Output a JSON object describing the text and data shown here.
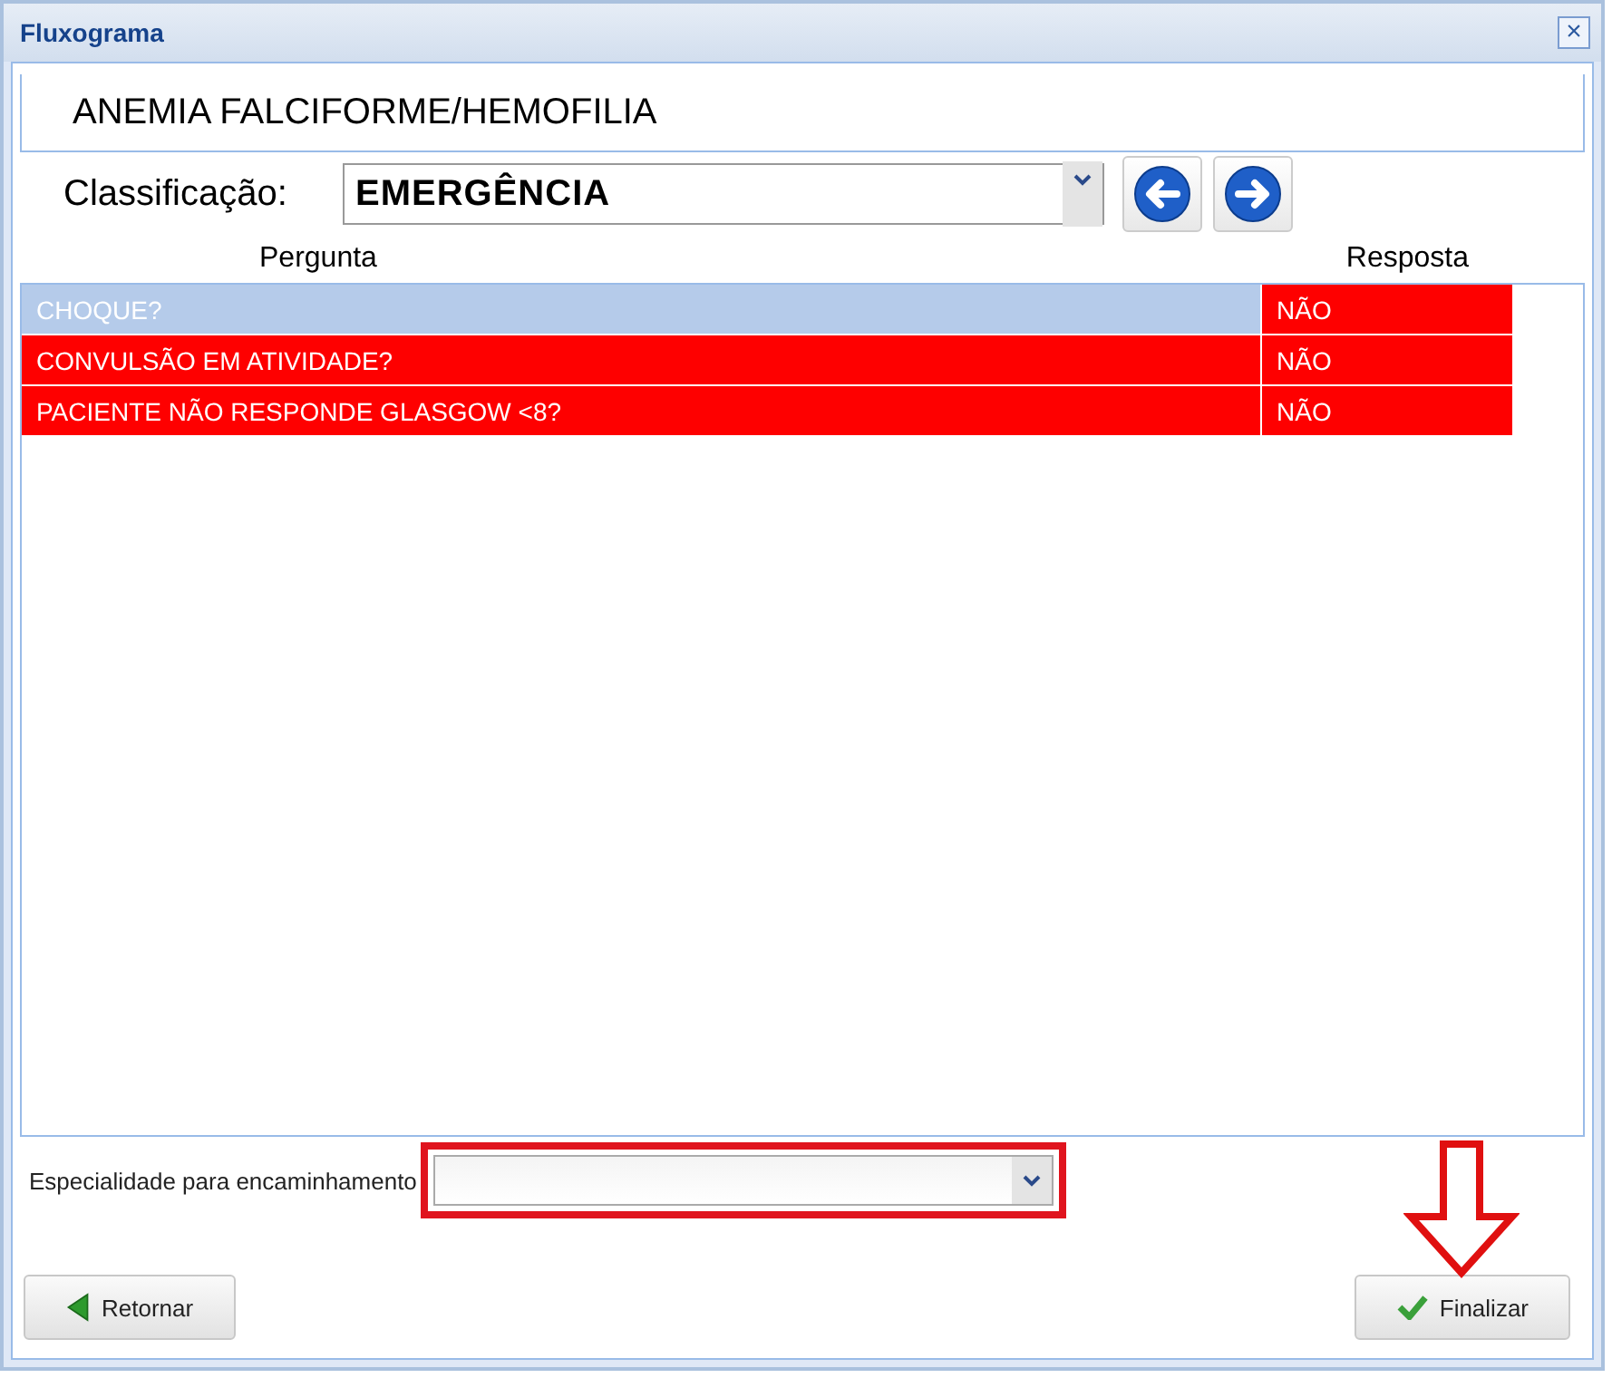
{
  "window": {
    "title": "Fluxograma",
    "close": "×"
  },
  "heading": "ANEMIA FALCIFORME/HEMOFILIA",
  "classification": {
    "label": "Classificação:",
    "value": "EMERGÊNCIA"
  },
  "table": {
    "columns": [
      "Pergunta",
      "Resposta"
    ],
    "rows": [
      {
        "question": "CHOQUE?",
        "answer": "NÃO",
        "selected": true
      },
      {
        "question": "CONVULSÃO EM ATIVIDADE?",
        "answer": "NÃO",
        "selected": false
      },
      {
        "question": "PACIENTE NÃO RESPONDE GLASGOW <8?",
        "answer": "NÃO",
        "selected": false
      }
    ]
  },
  "specialty": {
    "label": "Especialidade para encaminhamento"
  },
  "buttons": {
    "back": "Retornar",
    "finish": "Finalizar"
  }
}
